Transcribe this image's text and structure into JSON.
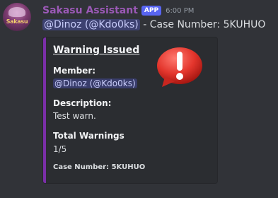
{
  "author": {
    "name": "Sakasu Assistant",
    "badge": "APP",
    "timestamp": "6:00 PM",
    "avatar_text": "Sakasu"
  },
  "message": {
    "mention": "@Dinoz (@Kdo0ks)",
    "text": " - Case Number: 5KUHUO"
  },
  "embed": {
    "accent_color": "#7b2fa8",
    "title": "Warning Issued",
    "thumbnail_icon": "red-exclamation-speech-bubble-icon",
    "fields": [
      {
        "name": "Member:",
        "value": "@Dinoz (@Kdo0ks)"
      },
      {
        "name": "Description:",
        "value": "Test warn."
      },
      {
        "name": "Total Warnings",
        "value": "1/5"
      }
    ],
    "footer": "Case Number: 5KUHUO"
  }
}
